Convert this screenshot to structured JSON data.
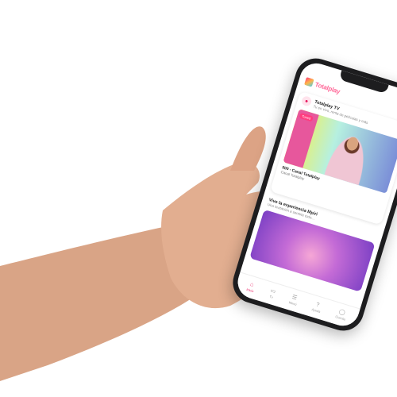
{
  "app": {
    "brand": "Totalplay"
  },
  "card": {
    "title": "Totalplay TV",
    "subtitle": "Tu en vivo, renta de películas y más",
    "live_tag": "Tuned",
    "channel_number": "500 - Canal Totalplay",
    "channel_name": "Canal Totalplay"
  },
  "section": {
    "title": "Vive la experiencia Mpiri",
    "subtitle": "Una invitación a sentirte todo..."
  },
  "tabs": [
    {
      "label": "Inicio",
      "icon": "home-icon"
    },
    {
      "label": "Tv",
      "icon": "tv-icon"
    },
    {
      "label": "Menú",
      "icon": "menu-icon"
    },
    {
      "label": "Ayuda",
      "icon": "help-icon"
    },
    {
      "label": "Cuenta",
      "icon": "account-icon"
    }
  ],
  "colors": {
    "accent": "#e91e63",
    "brand_pink": "#ff6b9a"
  }
}
